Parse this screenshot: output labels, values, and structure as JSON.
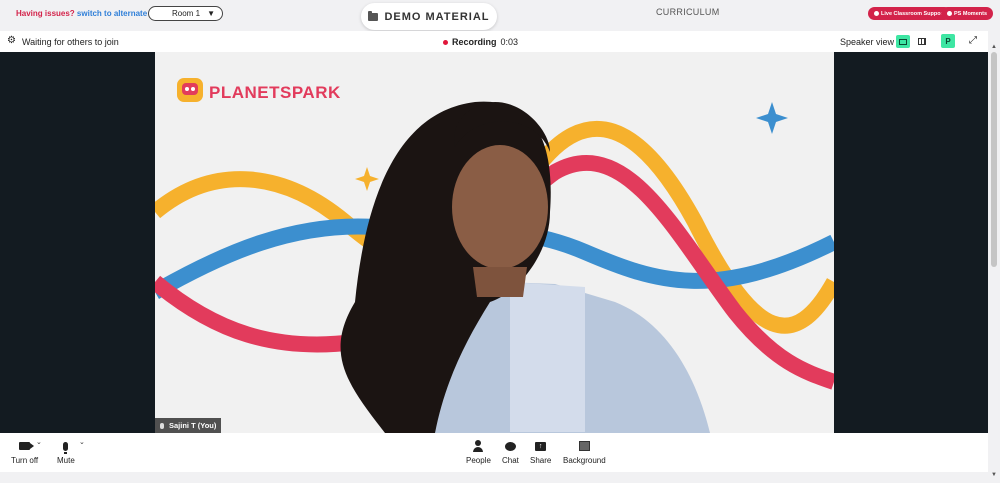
{
  "topbar": {
    "issues_text": "Having issues?",
    "alt_room_link": "switch to alternate room",
    "room_value": "Room 1",
    "demo_button": "DEMO MATERIAL",
    "curriculum": "CURRICULUM",
    "support_pill": "Live Classroom Support",
    "moments_pill": "PS Moments"
  },
  "meeting": {
    "status_text": "Waiting for others to join",
    "recording_label": "Recording",
    "recording_time": "0:03",
    "speaker_view": "Speaker view",
    "avatar_letter": "P",
    "participant_name": "Sajini T (You)"
  },
  "brand": {
    "logo_text": "PLANETSPARK"
  },
  "toolbar": {
    "video_label": "Turn off",
    "mute_label": "Mute",
    "people_label": "People",
    "chat_label": "Chat",
    "share_label": "Share",
    "background_label": "Background"
  },
  "colors": {
    "brand_red": "#d3234a",
    "accent_green": "#3ee6a3",
    "wave_yellow": "#f6b12d",
    "wave_blue": "#3c8fcf",
    "wave_red": "#e23b5c"
  }
}
